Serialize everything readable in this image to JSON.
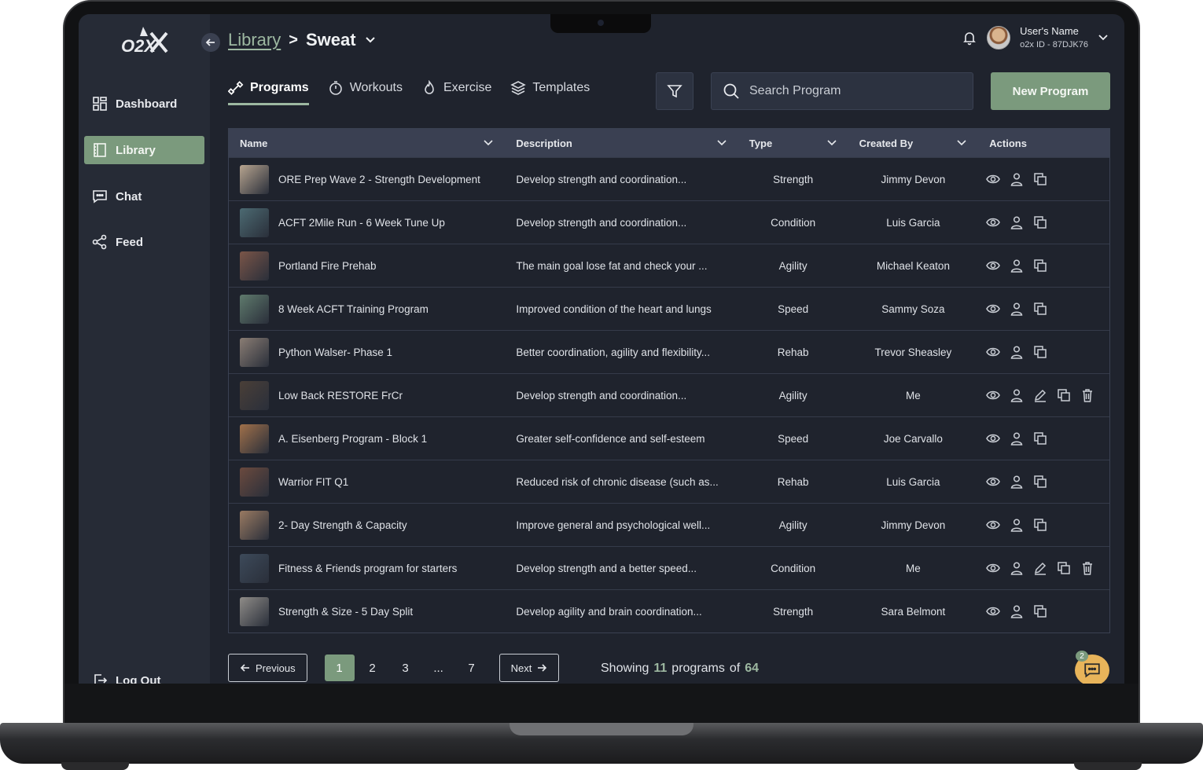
{
  "sidebar": {
    "items": [
      {
        "label": "Dashboard",
        "icon": "dashboard-icon"
      },
      {
        "label": "Library",
        "icon": "library-icon",
        "active": true
      },
      {
        "label": "Chat",
        "icon": "chat-icon"
      },
      {
        "label": "Feed",
        "icon": "share-icon"
      }
    ],
    "logout_label": "Log Out"
  },
  "breadcrumb": {
    "parent": "Library",
    "separator": ">",
    "current": "Sweat"
  },
  "user": {
    "name": "User's Name",
    "id": "o2x ID - 87DJK76"
  },
  "tabs": [
    {
      "label": "Programs",
      "icon": "programs-icon",
      "active": true
    },
    {
      "label": "Workouts",
      "icon": "stopwatch-icon"
    },
    {
      "label": "Exercise",
      "icon": "flame-icon"
    },
    {
      "label": "Templates",
      "icon": "layers-icon"
    }
  ],
  "search": {
    "placeholder": "Search Program"
  },
  "new_program_label": "New Program",
  "table": {
    "headers": {
      "name": "Name",
      "description": "Description",
      "type": "Type",
      "created_by": "Created By",
      "actions": "Actions"
    },
    "rows": [
      {
        "name": "ORE Prep Wave 2 - Strength Development",
        "description": "Develop strength and coordination...",
        "type": "Strength",
        "created_by": "Jimmy Devon",
        "owned": false,
        "thumb": "#b7a48f"
      },
      {
        "name": "ACFT 2Mile Run - 6 Week Tune Up",
        "description": "Develop strength and coordination...",
        "type": "Condition",
        "created_by": "Luis Garcia",
        "owned": false,
        "thumb": "#4c6a72"
      },
      {
        "name": "Portland Fire Prehab",
        "description": "The main goal lose fat and check your ...",
        "type": "Agility",
        "created_by": "Michael Keaton",
        "owned": false,
        "thumb": "#7a5548"
      },
      {
        "name": "8 Week ACFT Training Program",
        "description": "Improved condition of the heart and lungs",
        "type": "Speed",
        "created_by": "Sammy Soza",
        "owned": false,
        "thumb": "#5f7a6d"
      },
      {
        "name": "Python Walser- Phase 1",
        "description": "Better coordination, agility and flexibility...",
        "type": "Rehab",
        "created_by": "Trevor Sheasley",
        "owned": false,
        "thumb": "#8a7d74"
      },
      {
        "name": "Low Back RESTORE FrCr",
        "description": "Develop strength and coordination...",
        "type": "Agility",
        "created_by": "Me",
        "owned": true,
        "thumb": "#4a3f38"
      },
      {
        "name": "A. Eisenberg Program - Block 1",
        "description": "Greater self-confidence and self-esteem",
        "type": "Speed",
        "created_by": "Joe Carvallo",
        "owned": false,
        "thumb": "#a0704a"
      },
      {
        "name": "Warrior FIT Q1",
        "description": "Reduced risk of chronic disease (such as...",
        "type": "Rehab",
        "created_by": "Luis Garcia",
        "owned": false,
        "thumb": "#6b4a3e"
      },
      {
        "name": "2- Day Strength & Capacity",
        "description": "Improve general and psychological well...",
        "type": "Agility",
        "created_by": "Jimmy Devon",
        "owned": false,
        "thumb": "#9a7a62"
      },
      {
        "name": "Fitness & Friends program for starters",
        "description": "Develop strength and a better speed...",
        "type": "Condition",
        "created_by": "Me",
        "owned": true,
        "thumb": "#3d4a5a"
      },
      {
        "name": "Strength & Size - 5 Day Split",
        "description": "Develop agility and brain coordination...",
        "type": "Strength",
        "created_by": "Sara Belmont",
        "owned": false,
        "thumb": "#8f8c88"
      }
    ]
  },
  "pagination": {
    "previous_label": "Previous",
    "next_label": "Next",
    "pages": [
      "1",
      "2",
      "3",
      "...",
      "7"
    ],
    "current": "1",
    "showing_prefix": "Showing",
    "showing_count": "11",
    "showing_mid": "programs",
    "showing_of": "of",
    "showing_total": "64"
  },
  "chat_badge": "2",
  "colors": {
    "accent": "#7b9a7d",
    "link": "#9db8a1",
    "background": "#1f232d",
    "sidebar": "#262b36",
    "header_row": "#3a4052",
    "fab": "#e8b45a"
  }
}
